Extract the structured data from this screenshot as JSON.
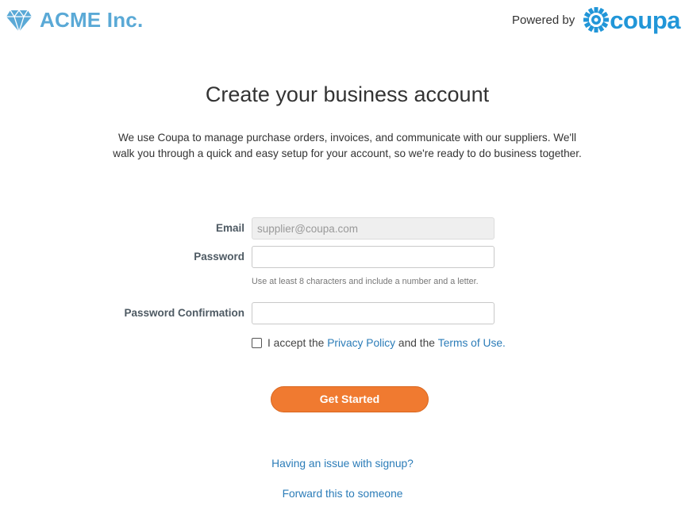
{
  "header": {
    "brand_name": "ACME Inc.",
    "powered_by_label": "Powered by",
    "partner_name": "coupa"
  },
  "main": {
    "title": "Create your business account",
    "intro": "We use Coupa to manage purchase orders, invoices, and communicate with our suppliers. We'll walk you through a quick and easy setup for your account, so we're ready to do business together."
  },
  "form": {
    "email_label": "Email",
    "email_value": "supplier@coupa.com",
    "password_label": "Password",
    "password_hint": "Use at least 8 characters and include a number and a letter.",
    "password_confirmation_label": "Password Confirmation",
    "accept_prefix": "I accept the",
    "privacy_policy_link": "Privacy Policy",
    "accept_middle": "and the",
    "terms_link": "Terms of Use.",
    "submit_label": "Get Started"
  },
  "footer": {
    "signup_issue_link": "Having an issue with signup?",
    "forward_link": "Forward this to someone"
  },
  "colors": {
    "brand": "#5aa9d6",
    "coupa": "#2196d8",
    "button": "#f07a30",
    "link": "#2b7cb8"
  }
}
